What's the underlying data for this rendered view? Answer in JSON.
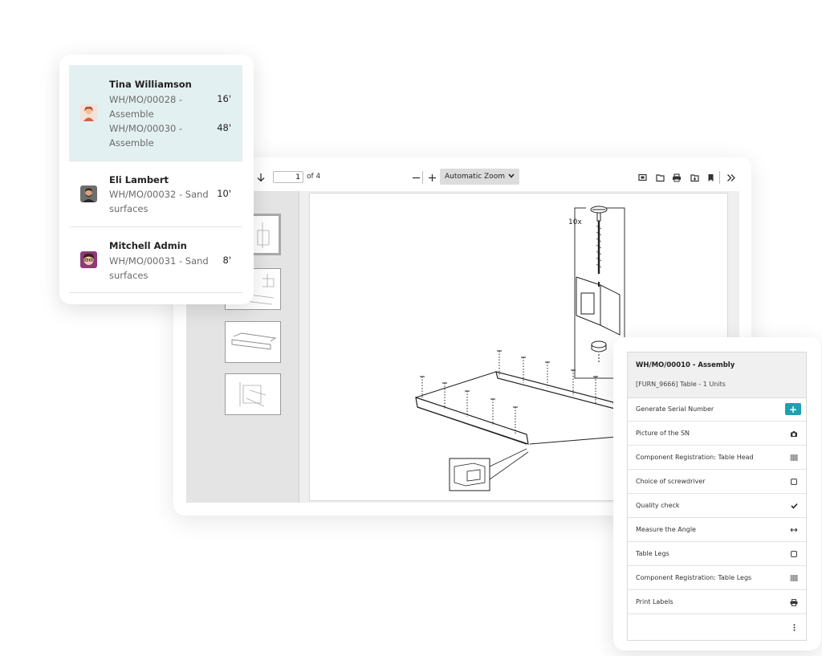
{
  "employees": [
    {
      "name": "Tina Williamson",
      "jobs": [
        {
          "ref": "WH/MO/00028 -",
          "op": "Assemble",
          "time": "16'"
        },
        {
          "ref": "WH/MO/00030 -",
          "op": "Assemble",
          "time": "48'"
        }
      ]
    },
    {
      "name": "Eli Lambert",
      "jobs": [
        {
          "ref": "WH/MO/00032 - Sand",
          "op": "surfaces",
          "time": "10'"
        }
      ]
    },
    {
      "name": "Mitchell Admin",
      "jobs": [
        {
          "ref": "WH/MO/00031 - Sand",
          "op": "surfaces",
          "time": "8'"
        }
      ]
    }
  ],
  "pdf_viewer": {
    "page_number": "1",
    "page_count_label": "of 4",
    "zoom": "Automatic Zoom",
    "callout_label": "10x",
    "icons": [
      "sidebar-toggle-icon",
      "arrow-down-icon",
      "zoom-out-icon",
      "zoom-in-icon",
      "presentation-icon",
      "open-file-icon",
      "print-icon",
      "download-icon",
      "bookmark-icon",
      "more-tools-icon"
    ]
  },
  "work_order": {
    "title": "WH/MO/00010 - Assembly",
    "subtitle": "[FURN_9666] Table - 1 Units",
    "steps": [
      {
        "label": "Generate Serial Number",
        "icon": "plus-icon"
      },
      {
        "label": "Picture of the SN",
        "icon": "camera-icon"
      },
      {
        "label": "Component Registration: Table Head",
        "icon": "barcode-icon"
      },
      {
        "label": "Choice of screwdriver",
        "icon": "checkbox-icon"
      },
      {
        "label": "Quality check",
        "icon": "check-icon"
      },
      {
        "label": "Measure the Angle",
        "icon": "measure-icon"
      },
      {
        "label": "Table Legs",
        "icon": "checkbox-icon"
      },
      {
        "label": "Component Registration: Table Legs",
        "icon": "barcode-icon"
      },
      {
        "label": "Print Labels",
        "icon": "print-icon"
      }
    ],
    "accent_color": "#1da1b2"
  },
  "colors": {
    "selected_row": "#e3f0f1"
  }
}
